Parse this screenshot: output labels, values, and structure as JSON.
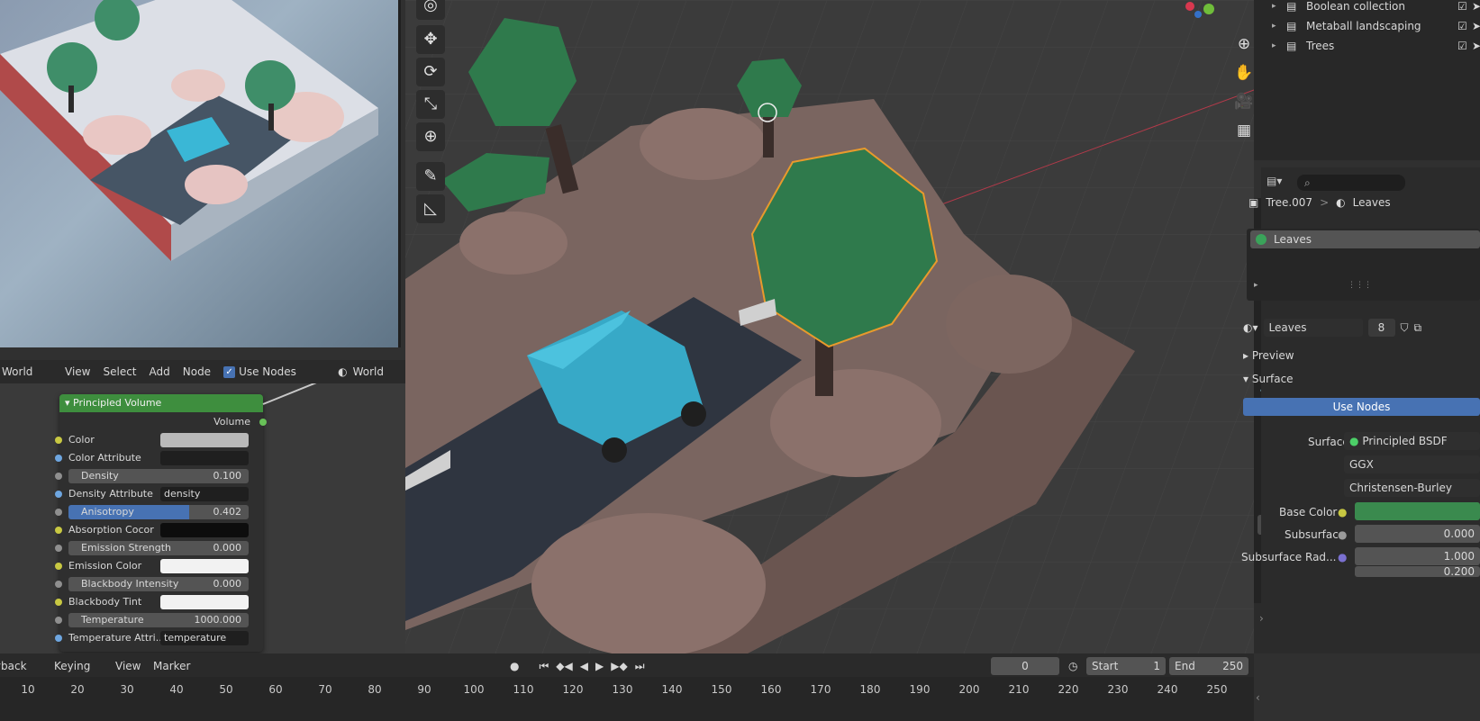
{
  "node_editor": {
    "menus": [
      "World",
      "View",
      "Select",
      "Add",
      "Node"
    ],
    "use_nodes_label": "Use Nodes",
    "world_label": "World",
    "node": {
      "title": "Principled Volume",
      "output": "Volume",
      "params": [
        {
          "label": "Color",
          "kind": "color",
          "color": "#b9b9b9",
          "socket": "#c8c842"
        },
        {
          "label": "Color Attribute",
          "kind": "field",
          "value": "",
          "socket": "#6ea6e0"
        },
        {
          "label": "Density",
          "kind": "slider",
          "value": "0.100",
          "socket": "#8f8f8f"
        },
        {
          "label": "Density Attribute",
          "kind": "field",
          "value": "density",
          "socket": "#6ea6e0"
        },
        {
          "label": "Anisotropy",
          "kind": "slider-active",
          "value": "0.402",
          "socket": "#8f8f8f"
        },
        {
          "label": "Absorption Cocor",
          "kind": "color",
          "color": "#0d0d0d",
          "socket": "#c8c842"
        },
        {
          "label": "Emission Strength",
          "kind": "slider",
          "value": "0.000",
          "socket": "#8f8f8f"
        },
        {
          "label": "Emission Color",
          "kind": "color",
          "color": "#f2f2f2",
          "socket": "#c8c842"
        },
        {
          "label": "Blackbody Intensity",
          "kind": "slider",
          "value": "0.000",
          "socket": "#8f8f8f"
        },
        {
          "label": "Blackbody Tint",
          "kind": "color",
          "color": "#f2f2f2",
          "socket": "#c8c842"
        },
        {
          "label": "Temperature",
          "kind": "slider",
          "value": "1000.000",
          "socket": "#8f8f8f"
        },
        {
          "label": "Temperature Attri...",
          "kind": "field",
          "value": "temperature",
          "socket": "#6ea6e0"
        }
      ]
    }
  },
  "viewport": {
    "tools": [
      "cursor-icon",
      "move-icon",
      "rotate-icon",
      "scale-icon",
      "transform-icon",
      "annotate-icon",
      "measure-icon"
    ],
    "nav": [
      "zoom-icon",
      "pan-icon",
      "camera-icon",
      "grid-icon"
    ]
  },
  "outliner": {
    "items": [
      {
        "label": "Boolean collection"
      },
      {
        "label": "Metaball landscaping"
      },
      {
        "label": "Trees"
      }
    ]
  },
  "properties": {
    "object": "Tree.007",
    "material_breadcrumb": "Leaves",
    "slot": "Leaves",
    "material_name": "Leaves",
    "users": "8",
    "preview": "Preview",
    "surface_panel": "Surface",
    "use_nodes": "Use Nodes",
    "surface_label": "Surface",
    "surface_value": "Principled BSDF",
    "distribution": "GGX",
    "sss_method": "Christensen-Burley",
    "base_color_label": "Base Color",
    "base_color": "#3a8a4e",
    "subsurface_label": "Subsurface",
    "subsurface_value": "0.000",
    "subsurface_radius_label": "Subsurface Rad...",
    "subsurface_radius_1": "1.000",
    "subsurface_radius_2": "0.200"
  },
  "timeline": {
    "menus": [
      "Playback",
      "Keying",
      "View",
      "Marker"
    ],
    "current_frame": "0",
    "start_label": "Start",
    "start": "1",
    "end_label": "End",
    "end": "250",
    "ticks": [
      "10",
      "20",
      "30",
      "40",
      "50",
      "60",
      "70",
      "80",
      "90",
      "100",
      "110",
      "120",
      "130",
      "140",
      "150",
      "160",
      "170",
      "180",
      "190",
      "200",
      "210",
      "220",
      "230",
      "240",
      "250"
    ]
  }
}
